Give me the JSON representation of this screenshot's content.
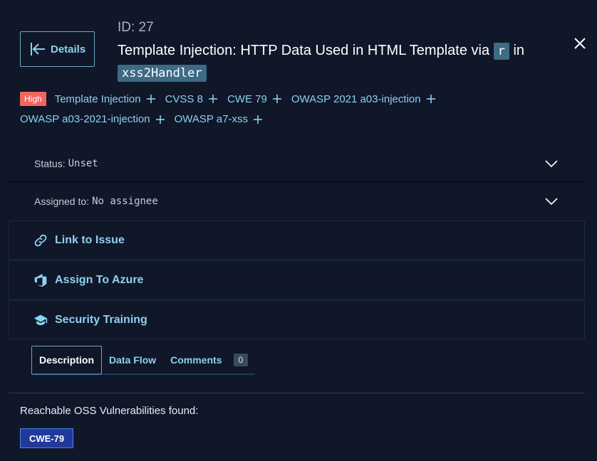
{
  "header": {
    "back_label": "Details",
    "id_label": "ID: 27",
    "title_prefix": "Template Injection: HTTP Data Used in HTML Template via",
    "title_code_var": "r",
    "title_in": "in",
    "title_code_handler": "xss2Handler"
  },
  "tags": {
    "severity": "High",
    "items": [
      "Template Injection",
      "CVSS 8",
      "CWE 79",
      "OWASP 2021 a03-injection",
      "OWASP a03-2021-injection",
      "OWASP a7-xss"
    ]
  },
  "status": {
    "label": "Status:",
    "value": "Unset"
  },
  "assigned": {
    "label": "Assigned to:",
    "value": "No assignee"
  },
  "actions": {
    "link_issue": "Link to Issue",
    "assign_azure": "Assign To Azure",
    "security_training": "Security Training"
  },
  "tabs": {
    "description": "Description",
    "data_flow": "Data Flow",
    "comments": "Comments",
    "comments_count": "0"
  },
  "content": {
    "reachable_text": "Reachable OSS Vulnerabilities found:",
    "cwe_chip": "CWE-79"
  },
  "colors": {
    "background": "#0f1729",
    "accent": "#8fd0f0",
    "high_badge": "#f2665e",
    "cwe_chip": "#1f3a9c"
  },
  "icons": {
    "back": "arrow-left-bar-icon",
    "close": "close-icon",
    "plus": "plus-icon",
    "chevron": "chevron-down-icon",
    "link": "link-icon",
    "azure": "azure-devops-icon",
    "training": "graduation-cap-icon"
  }
}
